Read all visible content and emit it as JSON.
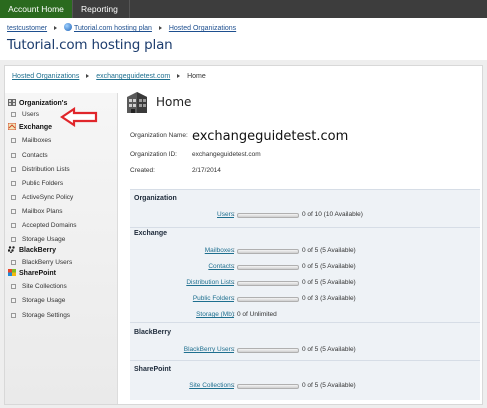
{
  "topnav": {
    "account_home": "Account Home",
    "reporting": "Reporting"
  },
  "breadcrumb": {
    "customer": "testcustomer",
    "plan": "Tutorial.com hosting plan",
    "hosted_orgs": "Hosted Organizations"
  },
  "page_title": "Tutorial.com hosting plan",
  "sub_breadcrumb": {
    "hosted_orgs": "Hosted Organizations",
    "org": "exchangeguidetest.com",
    "current": "Home"
  },
  "sidebar": {
    "org_header": "Organization's",
    "users": "Users",
    "exchange_header": "Exchange",
    "exchange_items": [
      "Mailboxes",
      "Contacts",
      "Distribution Lists",
      "Public Folders",
      "ActiveSync Policy",
      "Mailbox Plans",
      "Accepted Domains",
      "Storage Usage"
    ],
    "blackberry_header": "BlackBerry",
    "blackberry_items": [
      "BlackBerry Users"
    ],
    "sharepoint_header": "SharePoint",
    "sharepoint_items": [
      "Site Collections",
      "Storage Usage",
      "Storage Settings"
    ]
  },
  "main": {
    "title": "Home",
    "org_name_label": "Organization Name:",
    "org_name": "exchangeguidetest.com",
    "org_id_label": "Organization ID:",
    "org_id": "exchangeguidetest.com",
    "created_label": "Created:",
    "created": "2/17/2014",
    "sections": {
      "organization": "Organization",
      "exchange": "Exchange",
      "blackberry": "BlackBerry",
      "sharepoint": "SharePoint"
    },
    "quotas": {
      "users": {
        "label": "Users",
        "text": "0 of 10 (10 Available)"
      },
      "mailboxes": {
        "label": "Mailboxes",
        "text": "0 of 5 (5 Available)"
      },
      "contacts": {
        "label": "Contacts",
        "text": "0 of 5 (5 Available)"
      },
      "distribution_lists": {
        "label": "Distribution Lists",
        "text": "0 of 5 (5 Available)"
      },
      "public_folders": {
        "label": "Public Folders",
        "text": "0 of 3 (3 Available)"
      },
      "storage": {
        "label": "Storage (Mb)",
        "text": "0 of Unlimited"
      },
      "blackberry_users": {
        "label": "BlackBerry Users",
        "text": "0 of 5 (5 Available)"
      },
      "site_collections": {
        "label": "Site Collections",
        "text": "0 of 5 (5 Available)"
      }
    },
    "colon": ":"
  },
  "colors": {
    "topnav_bg": "#3d3d3d",
    "active_tab": "#2a6a1e",
    "link": "#1e6f8f",
    "title": "#1d3d6e",
    "arrow": "#e0262b"
  }
}
